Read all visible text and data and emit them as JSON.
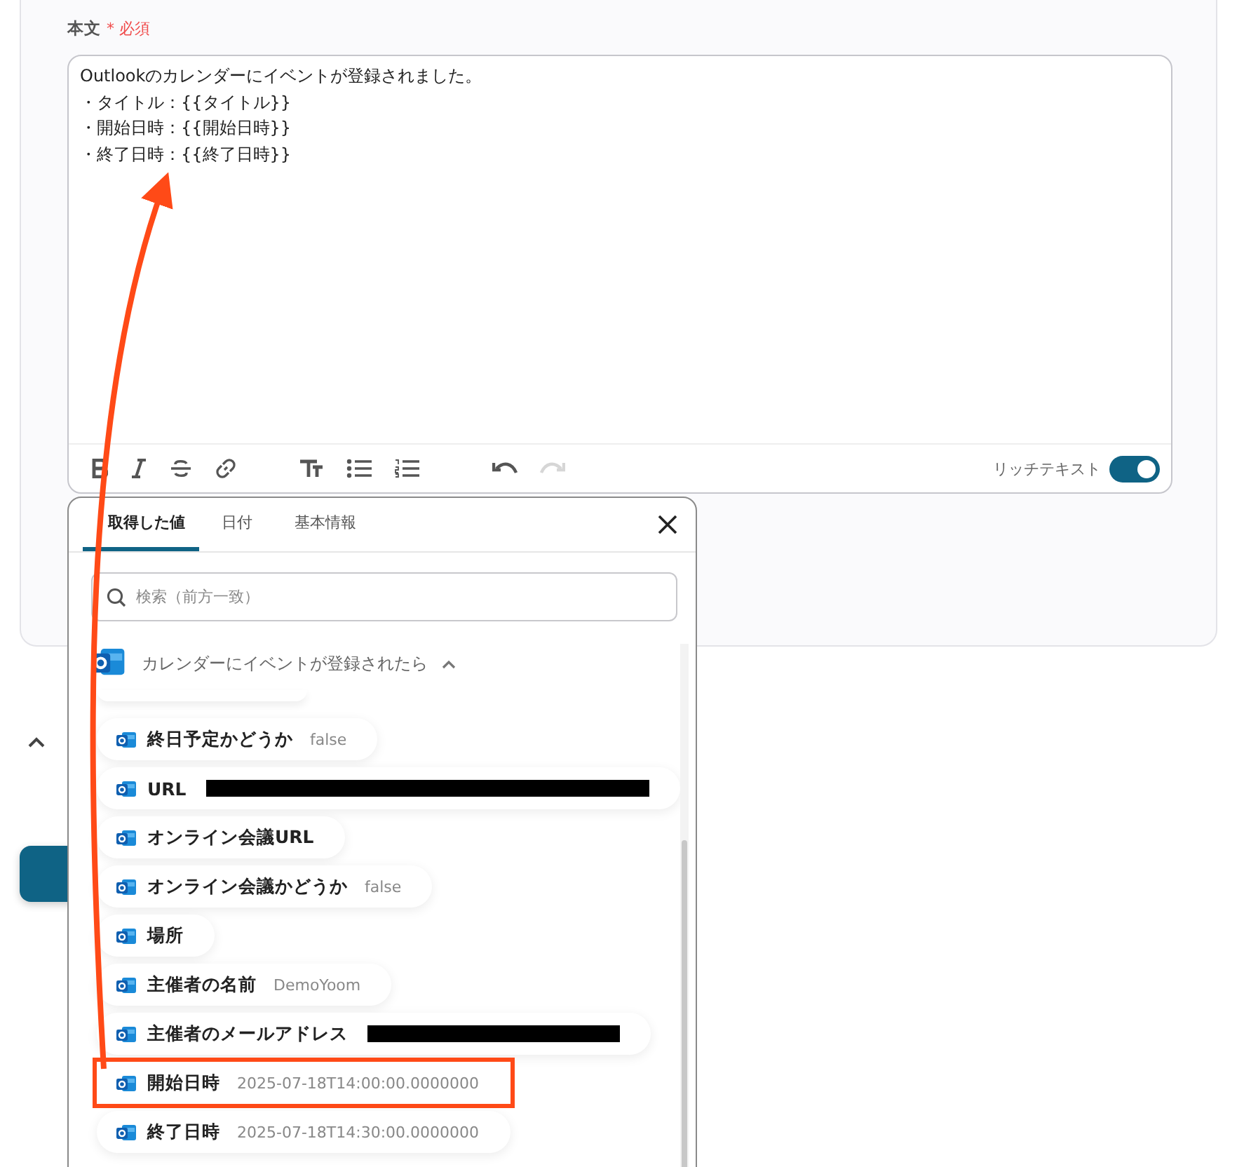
{
  "field": {
    "label": "本文",
    "required_mark": "*",
    "required_text": "必須",
    "value_lines": [
      "Outlookのカレンダーにイベントが登録されました。",
      "・タイトル：{{タイトル}}",
      "・開始日時：{{開始日時}}",
      "・終了日時：{{終了日時}}"
    ]
  },
  "toolbar": {
    "redo_enabled": false,
    "rich_text_label": "リッチテキスト",
    "rich_text_on": true
  },
  "popup": {
    "tabs": [
      {
        "label": "取得した値",
        "selected": true
      },
      {
        "label": "日付",
        "selected": false
      },
      {
        "label": "基本情報",
        "selected": false
      }
    ],
    "search": {
      "placeholder": "検索（前方一致）"
    },
    "group": {
      "title": "カレンダーにイベントが登録されたら",
      "expanded": true
    },
    "items": [
      {
        "label": "終日予定かどうか",
        "kind": "text",
        "value": "false",
        "highlighted": false
      },
      {
        "label": "URL",
        "kind": "redacted",
        "highlighted": false
      },
      {
        "label": "オンライン会議URL",
        "kind": "none",
        "highlighted": false
      },
      {
        "label": "オンライン会議かどうか",
        "kind": "text",
        "value": "false",
        "highlighted": false
      },
      {
        "label": "場所",
        "kind": "none",
        "highlighted": false
      },
      {
        "label": "主催者の名前",
        "kind": "text",
        "value": "DemoYoom",
        "highlighted": false
      },
      {
        "label": "主催者のメールアドレス",
        "kind": "redacted",
        "highlighted": false
      },
      {
        "label": "開始日時",
        "kind": "text",
        "value": "2025-07-18T14:00:00.0000000",
        "highlighted": true
      },
      {
        "label": "終了日時",
        "kind": "text",
        "value": "2025-07-18T14:30:00.0000000",
        "highlighted": false
      }
    ]
  }
}
